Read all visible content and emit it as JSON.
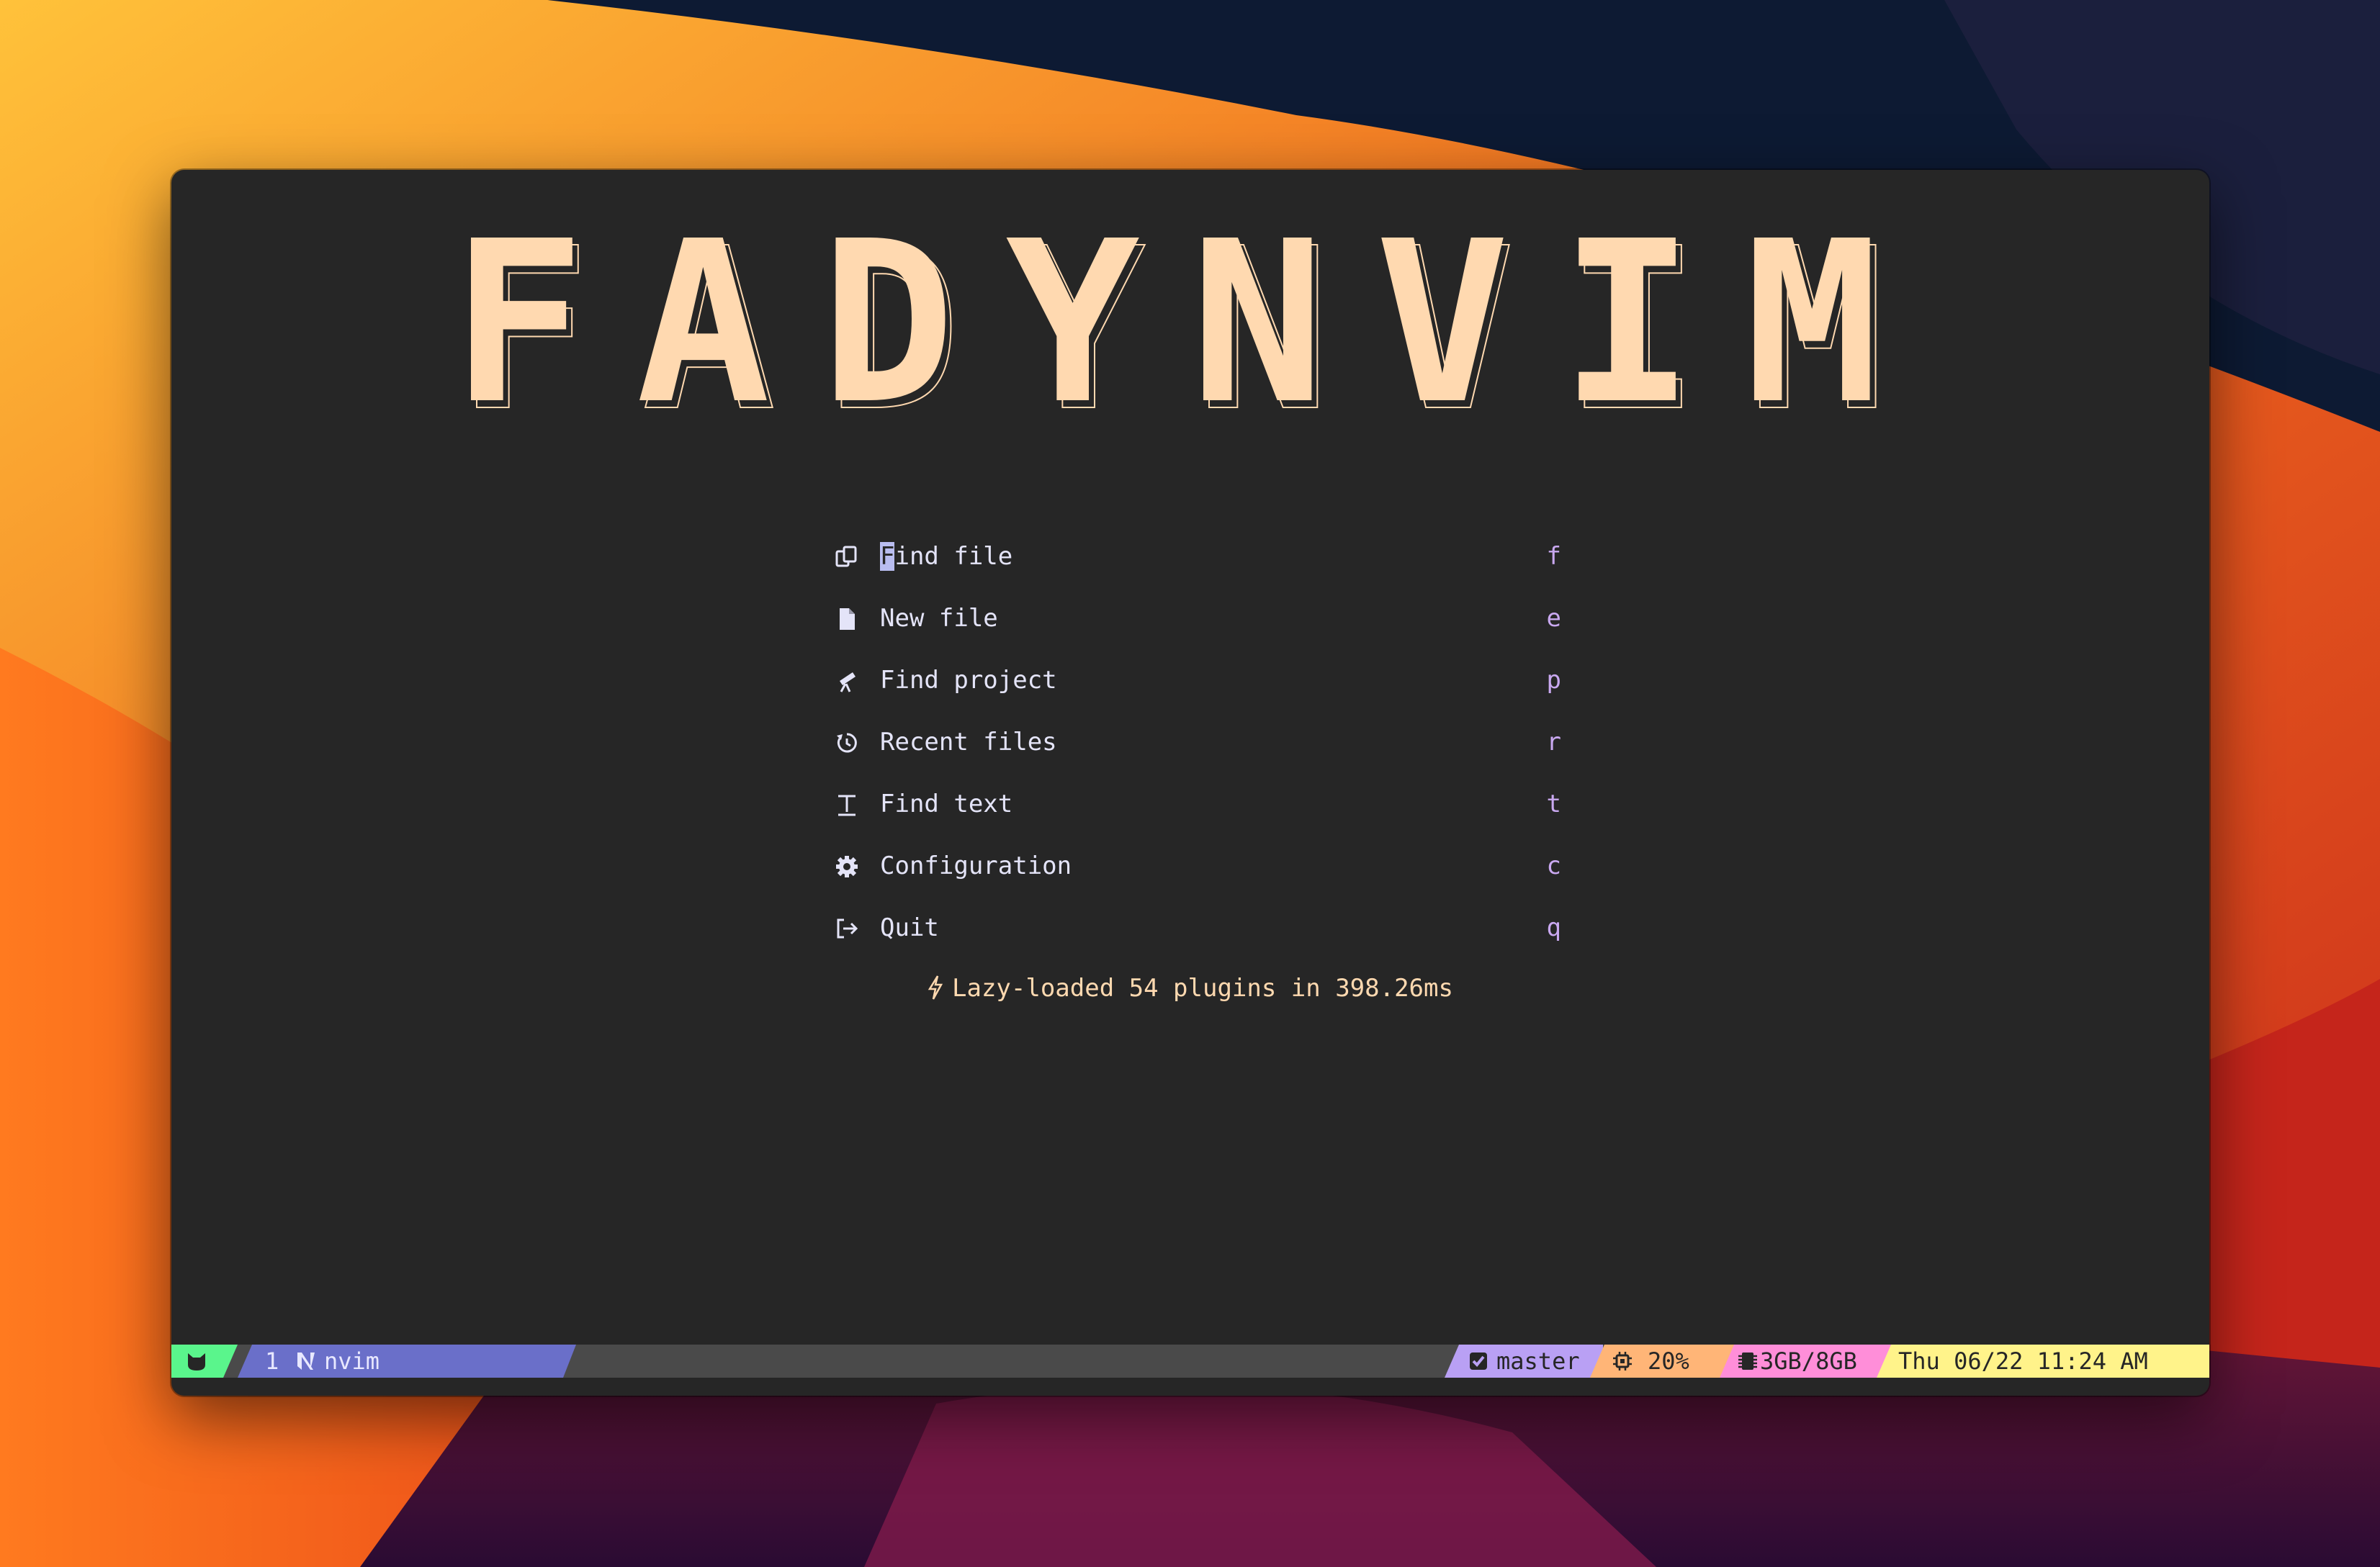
{
  "banner": {
    "title": "FADYNVIM"
  },
  "menu": {
    "items": [
      {
        "icon": "copy-files-icon",
        "label": "Find file",
        "key": "f"
      },
      {
        "icon": "file-icon",
        "label": "New file",
        "key": "e"
      },
      {
        "icon": "telescope-icon",
        "label": "Find project",
        "key": "p"
      },
      {
        "icon": "history-icon",
        "label": "Recent files",
        "key": "r"
      },
      {
        "icon": "text-icon",
        "label": "Find text",
        "key": "t"
      },
      {
        "icon": "gear-icon",
        "label": "Configuration",
        "key": "c"
      },
      {
        "icon": "sign-out-icon",
        "label": "Quit",
        "key": "q"
      }
    ],
    "first_item_cursor_char": "F",
    "first_item_rest": "ind file"
  },
  "footer": {
    "text": "Lazy-loaded 54 plugins in 398.26ms",
    "icon": "lightning-bolt-icon"
  },
  "statusbar": {
    "session_icon": "cat-face-icon",
    "window_index": "1",
    "window_icon": "neovim-logo-icon",
    "window_name": "nvim",
    "git_icon": "checkbox-icon",
    "git_branch": "master",
    "cpu_icon": "cpu-chip-icon",
    "cpu_usage": "20%",
    "memory_icon": "memory-icon",
    "memory_usage": "3GB/8GB",
    "datetime": "Thu 06/22 11:24 AM"
  },
  "colors": {
    "banner": "#ffd9b0",
    "label": "#e4e4f8",
    "key": "#c9a8f0",
    "terminal_bg": "#262626",
    "status_green": "#5af58c",
    "status_blue": "#6a6fc9",
    "status_purple": "#b9a0f4",
    "status_orange": "#ffb577",
    "status_pink": "#ff8ed9",
    "status_yellow": "#fff38a"
  }
}
